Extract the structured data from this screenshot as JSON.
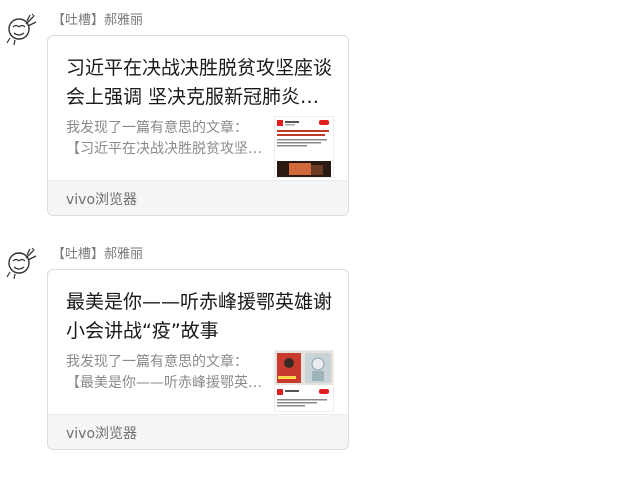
{
  "messages": [
    {
      "sender": "【吐槽】郝雅丽",
      "card": {
        "title": "习近平在决战决胜脱贫攻坚座谈会上强调 坚决克服新冠肺炎疫情影响 坚决夺取脱贫攻坚战全面胜利",
        "description": "我发现了一篇有意思的文章：【习近平在决战决胜脱贫攻坚座谈会上强调】",
        "source": "vivo浏览器"
      }
    },
    {
      "sender": "【吐槽】郝雅丽",
      "card": {
        "title": "最美是你——听赤峰援鄂英雄谢小会讲战“疫”故事",
        "description": "我发现了一篇有意思的文章：【最美是你——听赤峰援鄂英雄谢小会讲战“疫”故事】",
        "source": "vivo浏览器"
      }
    }
  ],
  "icons": {
    "avatar": "cartoon-avatar-icon",
    "thumbnail_badge": "red-badge-icon"
  },
  "colors": {
    "accent_red": "#e02020",
    "card_border": "#dcdcdc",
    "footer_bg": "#f4f5f7",
    "sender_text": "#7a7a7a",
    "title_text": "#1a1a1a",
    "desc_text": "#8a8a8a"
  }
}
